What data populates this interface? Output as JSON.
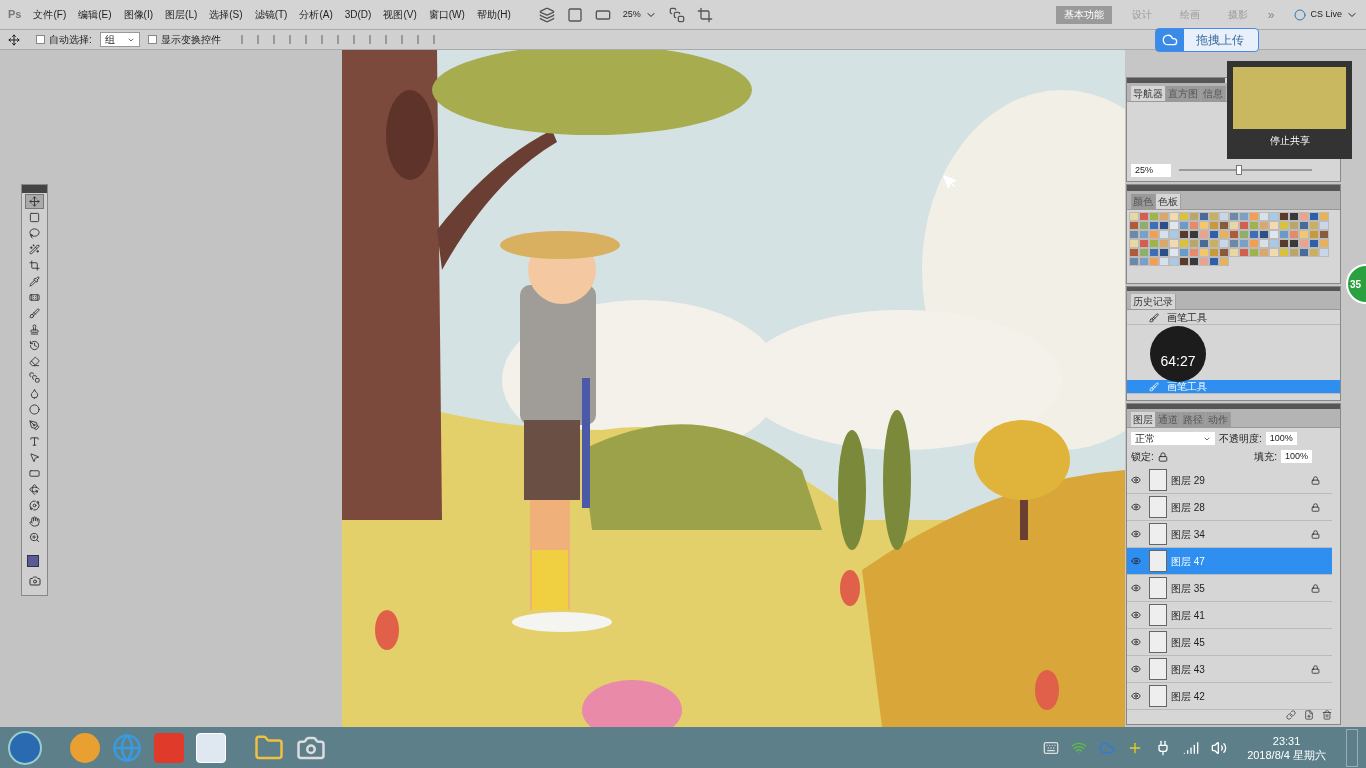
{
  "menu_bar": {
    "logo": "Ps",
    "items": [
      "文件(F)",
      "编辑(E)",
      "图像(I)",
      "图层(L)",
      "选择(S)",
      "滤镜(T)",
      "分析(A)",
      "3D(D)",
      "视图(V)",
      "窗口(W)",
      "帮助(H)"
    ],
    "zoom": "25%",
    "workspaces": [
      {
        "label": "基本功能",
        "selected": true
      },
      {
        "label": "设计",
        "selected": false
      },
      {
        "label": "绘画",
        "selected": false
      },
      {
        "label": "摄影",
        "selected": false
      }
    ],
    "more": "»",
    "cs_live": "CS Live"
  },
  "options_bar": {
    "auto_select": {
      "label": "自动选择:",
      "checked": false
    },
    "auto_select_target": "组",
    "show_transform": {
      "label": "显示变换控件",
      "checked": false
    }
  },
  "upload_button": "拖拽上传",
  "share_preview": {
    "button": "停止共享"
  },
  "timer": "64:27",
  "badge": "35",
  "toolbox": [
    {
      "kind": "move",
      "selected": true
    },
    {
      "kind": "marquee",
      "selected": false
    },
    {
      "kind": "lasso",
      "selected": false
    },
    {
      "kind": "wand",
      "selected": false
    },
    {
      "kind": "crop",
      "selected": false
    },
    {
      "kind": "eyedropper",
      "selected": false
    },
    {
      "kind": "heal",
      "selected": false
    },
    {
      "kind": "brush",
      "selected": false
    },
    {
      "kind": "stamp",
      "selected": false
    },
    {
      "kind": "history",
      "selected": false
    },
    {
      "kind": "eraser",
      "selected": false
    },
    {
      "kind": "gradient",
      "selected": false
    },
    {
      "kind": "blur",
      "selected": false
    },
    {
      "kind": "dodge",
      "selected": false
    },
    {
      "kind": "pen",
      "selected": false
    },
    {
      "kind": "type",
      "selected": false
    },
    {
      "kind": "select",
      "selected": false
    },
    {
      "kind": "shape",
      "selected": false
    },
    {
      "kind": "rotate3d",
      "selected": false
    },
    {
      "kind": "orbit3d",
      "selected": false
    },
    {
      "kind": "hand",
      "selected": false
    },
    {
      "kind": "zoom",
      "selected": false
    }
  ],
  "navigator": {
    "tabs": [
      {
        "label": "导航器",
        "selected": true
      },
      {
        "label": "直方图",
        "selected": false
      },
      {
        "label": "信息",
        "selected": false
      }
    ],
    "zoom": "25%",
    "zoom_slider": {
      "level": 0.45
    }
  },
  "swatches": {
    "tabs": [
      {
        "label": "颜色",
        "selected": false
      },
      {
        "label": "色板",
        "selected": true
      }
    ]
  },
  "history": {
    "tabs": [
      {
        "label": "历史记录",
        "selected": true
      }
    ],
    "items": [
      {
        "label": "画笔工具",
        "selected": false
      },
      {
        "label": "画笔工具",
        "selected": true
      }
    ]
  },
  "layers": {
    "tabs": [
      {
        "label": "图层",
        "selected": true
      },
      {
        "label": "通道",
        "selected": false
      },
      {
        "label": "路径",
        "selected": false
      },
      {
        "label": "动作",
        "selected": false
      }
    ],
    "blend_mode": "正常",
    "opacity_label": "不透明度:",
    "opacity": "100%",
    "lock_label": "锁定:",
    "fill_label": "填充:",
    "fill": "100%",
    "items": [
      {
        "name": "图层 29",
        "visible": true,
        "locked": true,
        "selected": false
      },
      {
        "name": "图层 28",
        "visible": true,
        "locked": true,
        "selected": false
      },
      {
        "name": "图层 34",
        "visible": true,
        "locked": true,
        "selected": false
      },
      {
        "name": "图层 47",
        "visible": true,
        "locked": false,
        "selected": true
      },
      {
        "name": "图层 35",
        "visible": true,
        "locked": true,
        "selected": false
      },
      {
        "name": "图层 41",
        "visible": true,
        "locked": false,
        "selected": false
      },
      {
        "name": "图层 45",
        "visible": true,
        "locked": false,
        "selected": false
      },
      {
        "name": "图层 43",
        "visible": true,
        "locked": true,
        "selected": false
      },
      {
        "name": "图层 42",
        "visible": true,
        "locked": false,
        "selected": false
      }
    ]
  },
  "taskbar": {
    "time": "23:31",
    "date": "2018/8/4 星期六"
  }
}
